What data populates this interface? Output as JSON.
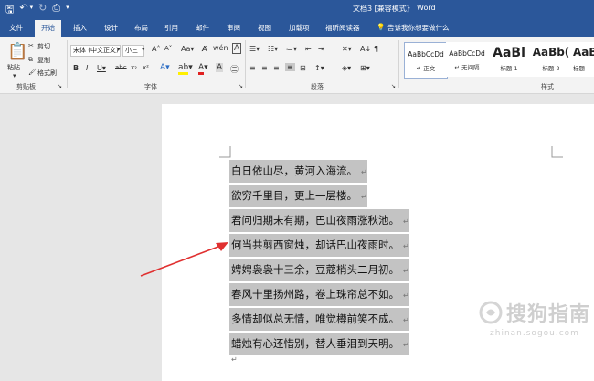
{
  "title": {
    "doc": "文档3 [兼容模式]",
    "app": "Word",
    "separator": "-"
  },
  "tabs": [
    "文件",
    "开始",
    "插入",
    "设计",
    "布局",
    "引用",
    "邮件",
    "审阅",
    "视图",
    "加载项",
    "福昕阅读器"
  ],
  "tell_me": "告诉我你想要做什么",
  "clipboard": {
    "paste": "粘贴",
    "cut": "剪切",
    "copy": "复制",
    "format_painter": "格式刷",
    "label": "剪贴板"
  },
  "font": {
    "name": "宋体 (中文正文)",
    "size": "小三",
    "label": "字体"
  },
  "paragraph": {
    "label": "段落"
  },
  "styles": {
    "label": "样式",
    "items": [
      {
        "preview": "AaBbCcDd",
        "name": "↵ 正文"
      },
      {
        "preview": "AaBbCcDd",
        "name": "↵ 无间隔"
      },
      {
        "preview": "AaBl",
        "name": "标题 1"
      },
      {
        "preview": "AaBb(",
        "name": "标题 2"
      },
      {
        "preview": "AaB",
        "name": "标题"
      }
    ]
  },
  "document": {
    "lines": [
      "白日依山尽，黄河入海流。",
      "欲穷千里目，更上一层楼。",
      "君问归期未有期，巴山夜雨涨秋池。",
      "何当共剪西窗烛，却话巴山夜雨时。",
      "娉娉袅袅十三余，豆蔻梢头二月初。",
      "春风十里扬州路，卷上珠帘总不如。",
      "多情却似总无情，唯觉樽前笑不成。",
      "蜡烛有心还惜别，替人垂泪到天明。"
    ],
    "paragraph_mark": "↵"
  },
  "watermark": {
    "cn": "搜狗指南",
    "en": "zhinan.sogou.com"
  },
  "colors": {
    "ribbon_blue": "#2b579a",
    "highlight": "#c3c3c3",
    "arrow": "#e03030"
  }
}
